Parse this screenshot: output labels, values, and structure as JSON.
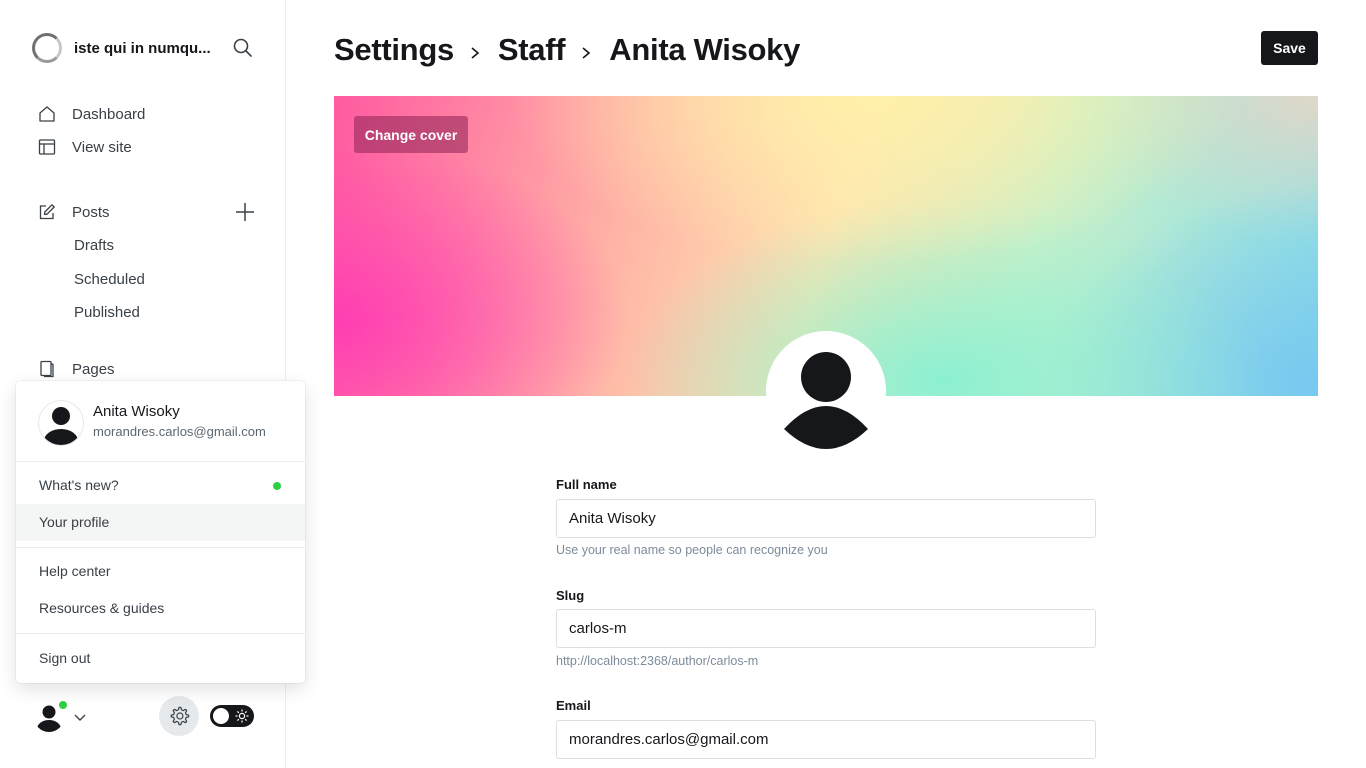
{
  "site": {
    "title": "iste qui in numqu..."
  },
  "nav": {
    "dashboard": "Dashboard",
    "view_site": "View site",
    "posts": "Posts",
    "drafts": "Drafts",
    "scheduled": "Scheduled",
    "published": "Published",
    "pages": "Pages"
  },
  "user_menu": {
    "name": "Anita Wisoky",
    "email": "morandres.carlos@gmail.com",
    "whats_new": "What's new?",
    "your_profile": "Your profile",
    "help_center": "Help center",
    "resources": "Resources & guides",
    "sign_out": "Sign out",
    "status_color": "#30cf43"
  },
  "header": {
    "crumb_settings": "Settings",
    "crumb_staff": "Staff",
    "crumb_user": "Anita Wisoky",
    "save_label": "Save"
  },
  "cover": {
    "change_label": "Change cover"
  },
  "form": {
    "full_name_label": "Full name",
    "full_name_value": "Anita Wisoky",
    "full_name_hint": "Use your real name so people can recognize you",
    "slug_label": "Slug",
    "slug_value": "carlos-m",
    "slug_hint": "http://localhost:2368/author/carlos-m",
    "email_label": "Email",
    "email_value": "morandres.carlos@gmail.com"
  },
  "theme": {
    "dark_mode": false
  }
}
